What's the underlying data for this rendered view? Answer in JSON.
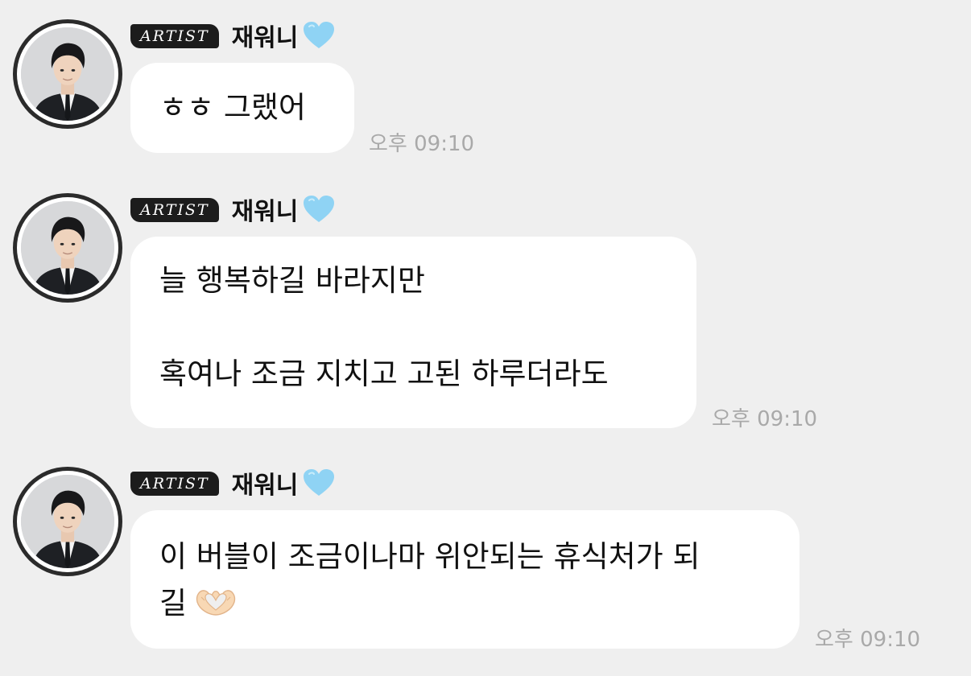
{
  "messages": [
    {
      "badge": "ARTIST",
      "sender": "재워니",
      "lines": [
        "ㅎㅎ 그랬어"
      ],
      "time": "오후 09:10"
    },
    {
      "badge": "ARTIST",
      "sender": "재워니",
      "lines": [
        "늘 행복하길 바라지만",
        "",
        "혹여나 조금 지치고 고된 하루더라도"
      ],
      "time": "오후 09:10"
    },
    {
      "badge": "ARTIST",
      "sender": "재워니",
      "lines": [
        "이 버블이 조금이나마 위안되는 휴식처가 되",
        "길"
      ],
      "emoji": "heart-hands-icon",
      "time": "오후 09:10"
    }
  ],
  "icons": {
    "name_suffix": "light-blue-heart-icon",
    "heart_color": "#8fd3f4"
  },
  "colors": {
    "background": "#efefef",
    "bubble": "#ffffff",
    "badge": "#1c1c1c",
    "time": "#a9a9a9"
  }
}
